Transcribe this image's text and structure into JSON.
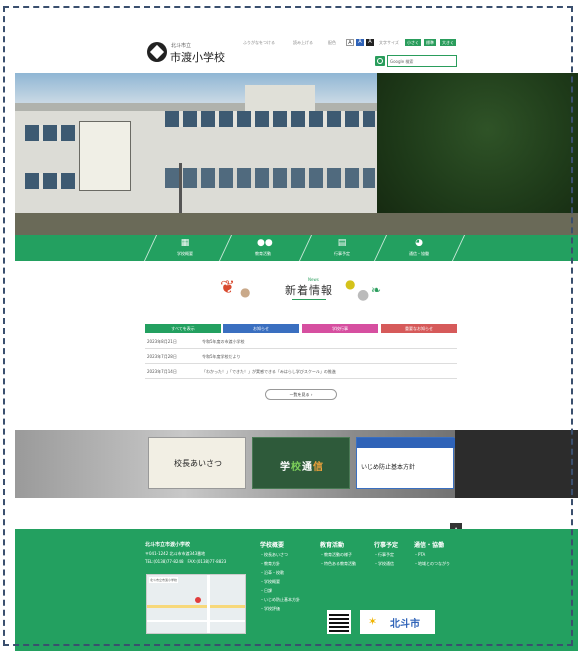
{
  "header": {
    "school_sub": "北斗市立",
    "school_name": "市渡小学校",
    "util_links": [
      "ふりがなをつける",
      "読み上げる",
      "配色"
    ],
    "font_size_label": "文字サイズ",
    "sizes": [
      "小さく",
      "標準",
      "大きく"
    ],
    "search_placeholder": "Google 検索"
  },
  "nav": [
    {
      "label": "学校概要",
      "icon": "building-icon",
      "glyph": "🏫"
    },
    {
      "label": "教育活動",
      "icon": "people-icon",
      "glyph": "👥"
    },
    {
      "label": "行事予定",
      "icon": "calendar-icon",
      "glyph": "📅"
    },
    {
      "label": "通信・協働",
      "icon": "chat-icon",
      "glyph": "💬"
    }
  ],
  "news": {
    "title": "新着情報",
    "subtitle": "News",
    "tabs": [
      {
        "label": "すべてを表示",
        "color": "#23a060"
      },
      {
        "label": "お知らせ",
        "color": "#3a6fc0"
      },
      {
        "label": "学校行事",
        "color": "#d64fa0"
      },
      {
        "label": "重要なお知らせ",
        "color": "#d65a5a"
      }
    ],
    "items": [
      {
        "date": "2023年8月21日",
        "title": "令和5年度の市渡小学校"
      },
      {
        "date": "2023年7月28日",
        "title": "令和5年度学校だより"
      },
      {
        "date": "2023年7月14日",
        "title": "「わかった！」「できた！」が実感できる「みはらし学びスクール」の推進"
      }
    ],
    "more_label": "一覧を見る"
  },
  "banners": {
    "principal": "校長あいさつ",
    "newsletter_chars": [
      "学",
      "校",
      "通",
      "信"
    ],
    "newsletter_colors": [
      "#ffffff",
      "#7ccf5a",
      "#ffffff",
      "#f0a23a"
    ],
    "bullying": "いじめ防止基本方針"
  },
  "footer": {
    "school": "北斗市立市渡小学校",
    "address": "〒041-1242 北斗市市渡343番地",
    "phone": "TEL:(0138)77-8248　FAX:(0138)77-8823",
    "cols": [
      {
        "head": "学校概要",
        "items": [
          "校長あいさつ",
          "教育方針",
          "沿革・校歌",
          "学校概要",
          "日課",
          "いじめ防止基本方針",
          "学校評価"
        ]
      },
      {
        "head": "教育活動",
        "items": [
          "教育活動の様子",
          "特色ある教育活動"
        ]
      },
      {
        "head": "行事予定",
        "items": [
          "行事予定",
          "学校通信"
        ]
      },
      {
        "head": "通信・協働",
        "items": [
          "PTA",
          "地域とのつながり"
        ]
      }
    ],
    "map_label": "北斗市立市渡小学校",
    "city": "北斗市",
    "totop": "▲"
  }
}
